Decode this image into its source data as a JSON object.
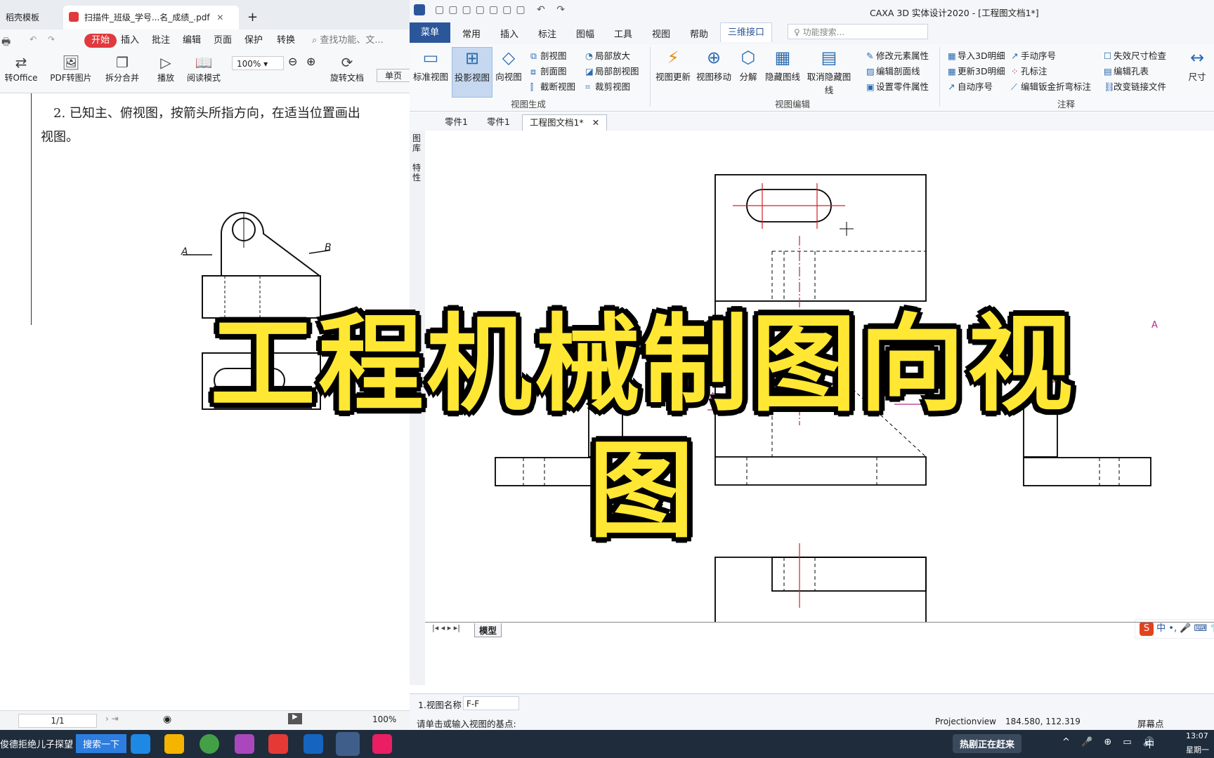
{
  "wps": {
    "tabs": [
      {
        "label": "稻壳模板"
      },
      {
        "label": "扫描件_班级_学号...名_成绩_.pdf"
      }
    ],
    "new_tab": "+",
    "menu": [
      "开始",
      "插入",
      "批注",
      "编辑",
      "页面",
      "保护",
      "转换"
    ],
    "search_placeholder": "查找功能、文...",
    "toolbar": [
      {
        "label": "转Office"
      },
      {
        "label": "PDF转图片"
      },
      {
        "label": "拆分合并"
      },
      {
        "label": "播放"
      },
      {
        "label": "阅读模式"
      },
      {
        "label": "旋转文档"
      },
      {
        "label": "单页"
      }
    ],
    "zoom": "100%",
    "doc_text_line1": "2. 已知主、俯视图，按箭头所指方向，在适当位置画出",
    "doc_text_line2": "视图。",
    "arrow_label_a": "A",
    "arrow_label_b": "B",
    "page_indicator": "1/1",
    "status_zoom": "100%"
  },
  "caxa": {
    "title": "CAXA 3D 实体设计2020 - [工程图文档1*]",
    "menubar": [
      "菜单",
      "常用",
      "插入",
      "标注",
      "图幅",
      "工具",
      "视图",
      "帮助",
      "三维接口"
    ],
    "search_placeholder": "功能搜索...",
    "ribbon": {
      "view_gen": {
        "group": "视图生成",
        "big": [
          "标准视图",
          "投影视图",
          "向视图"
        ],
        "small": [
          "剖视图",
          "剖面图",
          "截断视图",
          "局部放大",
          "局部剖视图",
          "裁剪视图"
        ]
      },
      "view_edit": {
        "group": "视图编辑",
        "big": [
          "视图更新",
          "视图移动",
          "分解",
          "隐藏图线",
          "取消隐藏图线"
        ],
        "small": [
          "修改元素属性",
          "编辑剖面线",
          "设置零件属性"
        ]
      },
      "annotation": {
        "group": "注释",
        "small": [
          "导入3D明细",
          "更新3D明细",
          "自动序号",
          "手动序号",
          "孔标注",
          "编辑钣金折弯标注",
          "失效尺寸检查",
          "编辑孔表",
          "改变链接文件"
        ],
        "big": [
          "尺寸"
        ]
      }
    },
    "doc_tabs": [
      "零件1",
      "零件1",
      "工程图文档1*"
    ],
    "side_tabs": [
      "图库",
      "特性"
    ],
    "model_tab": "模型",
    "view_name_label": "1.视图名称",
    "view_name_value": "F-F",
    "prompt": "请单击或输入视图的基点:",
    "status_mode": "Projectionview",
    "status_coords": "184.580, 112.319",
    "status_snap": "屏幕点",
    "drawing_labels": {
      "a1": "A",
      "a2": "A",
      "b": "B"
    },
    "ime": "中"
  },
  "taskbar": {
    "news": "俊德拒绝儿子探望",
    "search": "搜索一下",
    "hot": "热剧正在赶来",
    "ime": "中",
    "time": "13:07",
    "date": "星期一"
  },
  "caption": "工程机械制图向视图",
  "colors": {
    "accent": "#2b579a",
    "caption": "#ffe733",
    "wps_red": "#e0393e"
  }
}
